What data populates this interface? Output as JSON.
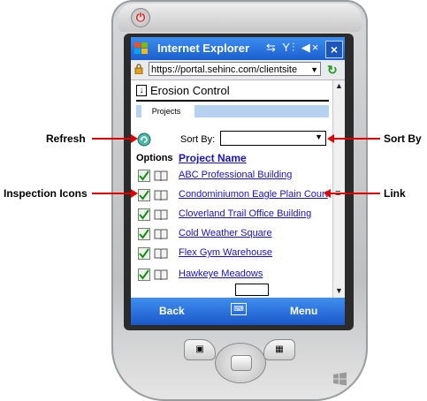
{
  "browser": {
    "title": "Internet Explorer",
    "status_icons": "⇆ Y⫶ ◀×",
    "close": "×",
    "url": "https://portal.sehinc.com/clientsite"
  },
  "app": {
    "title": "Erosion Control",
    "tab_projects": "Projects",
    "sort_label": "Sort By:",
    "col_options": "Options",
    "col_project": "Project Name",
    "projects": [
      "ABC Professional Building",
      "Condominiumon Eagle Plain Court",
      "Cloverland Trail Office Building",
      "Cold Weather Square",
      "Flex Gym Warehouse",
      "Hawkeye Meadows"
    ]
  },
  "softkeys": {
    "left": "Back",
    "right": "Menu"
  },
  "callouts": {
    "refresh": "Refresh",
    "sort_by": "Sort By",
    "inspection_icons": "Inspection Icons",
    "link": "Link"
  },
  "colors": {
    "accent": "#1a5ecf",
    "link": "#1a12c8",
    "arrow": "#e00000"
  },
  "icons": [
    "power-icon",
    "windows-flag-icon",
    "lock-icon",
    "go-arrow-icon",
    "download-icon",
    "refresh-icon",
    "check-icon",
    "book-icon",
    "keyboard-icon",
    "windows-logo-icon"
  ]
}
